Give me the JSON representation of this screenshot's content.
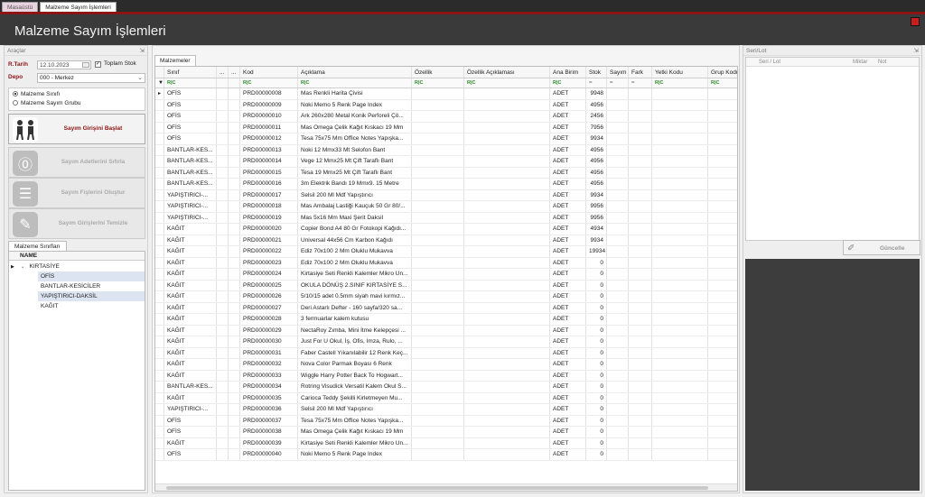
{
  "top_tabs": [
    {
      "label": "Masaüstü",
      "active": false
    },
    {
      "label": "Malzeme Sayım İşlemleri",
      "active": true
    }
  ],
  "header": {
    "title": "Malzeme Sayım İşlemleri"
  },
  "left": {
    "panel_title": "Araçlar",
    "pin": "⇲",
    "date_label": "R.Tarih",
    "date_value": "12.10.2023",
    "total_stock_label": "Toplam Stok",
    "total_stock_checked": true,
    "depo_label": "Depo",
    "depo_value": "000 - Merkez",
    "radio_options": [
      {
        "label": "Malzeme Sınıfı",
        "selected": true
      },
      {
        "label": "Malzeme Sayım Grubu",
        "selected": false
      }
    ],
    "buttons": [
      {
        "label": "Sayım Girişini Başlat",
        "enabled": true
      },
      {
        "label": "Sayım Adetlerini Sıfırla",
        "enabled": false
      },
      {
        "label": "Sayım Fişlerini Oluştur",
        "enabled": false
      },
      {
        "label": "Sayım Girişlerini Temizle",
        "enabled": false
      }
    ],
    "tree_tab": "Malzeme Sınıfları",
    "tree_header": "NAME",
    "tree": {
      "root": "KIRTASİYE",
      "children": [
        "OFİS",
        "BANTLAR-KESİCİLER",
        "YAPIŞTIRICI-DAKSİL",
        "KAĞIT"
      ]
    }
  },
  "grid": {
    "tab": "Malzemeler",
    "columns": [
      "Sınıf",
      "...",
      "...",
      "Kod",
      "Açıklama",
      "Özellik",
      "Özellik Açıklaması",
      "Ana Birim",
      "Stok",
      "Sayım",
      "Fark",
      "Yetki Kodu",
      "Grup Kodu"
    ],
    "filter_badge": "R|C",
    "filter_dash": "=",
    "rows": [
      [
        "OFİS",
        "PRD00000008",
        "Mas Renkli Harita Çivisi",
        "ADET",
        "9948"
      ],
      [
        "OFİS",
        "PRD00000009",
        "Noki Memo 5 Renk Page Index",
        "ADET",
        "4956"
      ],
      [
        "OFİS",
        "PRD00000010",
        "Ark 260x280 Metal Konik Perforeli Çö...",
        "ADET",
        "2456"
      ],
      [
        "OFİS",
        "PRD00000011",
        "Mas Omega Çelik Kağıt Kıskacı 19 Mm",
        "ADET",
        "7956"
      ],
      [
        "OFİS",
        "PRD00000012",
        "Tesa 75x75 Mm Office Notes Yapışka...",
        "ADET",
        "9934"
      ],
      [
        "BANTLAR-KES...",
        "PRD00000013",
        "Noki 12 Mmx33 Mt Selofon Bant",
        "ADET",
        "4956"
      ],
      [
        "BANTLAR-KES...",
        "PRD00000014",
        "Vege 12 Mmx25 Mt Çift Taraflı Bant",
        "ADET",
        "4956"
      ],
      [
        "BANTLAR-KES...",
        "PRD00000015",
        "Tesa 19 Mmx25 Mt Çift Taraflı Bant",
        "ADET",
        "4956"
      ],
      [
        "BANTLAR-KES...",
        "PRD00000016",
        "3m Elektrik Bandı 19 Mmx9. 15 Metre",
        "ADET",
        "4956"
      ],
      [
        "YAPIŞTIRICI-...",
        "PRD00000017",
        "Selsil 200 Ml Mdf Yapıştırıcı",
        "ADET",
        "9934"
      ],
      [
        "YAPIŞTIRICI-...",
        "PRD00000018",
        "Mas Ambalaj Lastiği Kauçuk 50 Gr 80/...",
        "ADET",
        "9956"
      ],
      [
        "YAPIŞTIRICI-...",
        "PRD00000019",
        "Mas 5x16 Mm Maxi Şerit Daksil",
        "ADET",
        "9956"
      ],
      [
        "KAĞIT",
        "PRD00000020",
        "Copier Bond A4 80 Gr Fotokopi Kağıdı...",
        "ADET",
        "4934"
      ],
      [
        "KAĞIT",
        "PRD00000021",
        "Universal 44x56 Cm Karbon Kağıdı",
        "ADET",
        "9934"
      ],
      [
        "KAĞIT",
        "PRD00000022",
        "Ediz 70x100 2 Mm Oluklu Mukavva",
        "ADET",
        "19934"
      ],
      [
        "KAĞIT",
        "PRD00000023",
        "Ediz 70x100 2 Mm Oluklu Mukavva",
        "ADET",
        "0"
      ],
      [
        "KAĞIT",
        "PRD00000024",
        "Kirtasiye Seti Renkli Kalemler Mikro Un...",
        "ADET",
        "0"
      ],
      [
        "KAĞIT",
        "PRD00000025",
        "OKULA DÖNÜŞ 2.SINIF KIRTASİYE S...",
        "ADET",
        "0"
      ],
      [
        "KAĞIT",
        "PRD00000026",
        "5/10/15 adet 0.5mm siyah mavi kırmız...",
        "ADET",
        "0"
      ],
      [
        "KAĞIT",
        "PRD00000027",
        "Deri Astarlı Defter - 160 sayfa/320 sa...",
        "ADET",
        "0"
      ],
      [
        "KAĞIT",
        "PRD00000028",
        "3 fermuarlar kalem kutusu",
        "ADET",
        "0"
      ],
      [
        "KAĞIT",
        "PRD00000029",
        "NectaRoy Zımba, Mini İtme Kelepçesi ...",
        "ADET",
        "0"
      ],
      [
        "KAĞIT",
        "PRD00000030",
        "Just For U Okul, İş, Ofis, Imza, Rulo, ...",
        "ADET",
        "0"
      ],
      [
        "KAĞIT",
        "PRD00000031",
        "Faber Castell Yıkanılabilir 12 Renk Keç...",
        "ADET",
        "0"
      ],
      [
        "KAĞIT",
        "PRD00000032",
        "Nova Color Parmak Boyası 6 Renk",
        "ADET",
        "0"
      ],
      [
        "KAĞIT",
        "PRD00000033",
        "Wiggle Harry Potter Back To Hogwart...",
        "ADET",
        "0"
      ],
      [
        "BANTLAR-KES...",
        "PRD00000034",
        "Rotring Visudick Versatil Kalem Okul S...",
        "ADET",
        "0"
      ],
      [
        "KAĞIT",
        "PRD00000035",
        "Carioca Teddy Şekilli Kirletmeyen Mu...",
        "ADET",
        "0"
      ],
      [
        "YAPIŞTIRICI-...",
        "PRD00000036",
        "Selsil 200 Ml Mdf Yapıştırıcı",
        "ADET",
        "0"
      ],
      [
        "OFİS",
        "PRD00000037",
        "Tesa 75x75 Mm Office Notes Yapışka...",
        "ADET",
        "0"
      ],
      [
        "OFİS",
        "PRD00000038",
        "Mas Omega Çelik Kağıt Kıskacı 19 Mm",
        "ADET",
        "0"
      ],
      [
        "KAĞIT",
        "PRD00000039",
        "Kirtasiye Seti Renkli Kalemler Mikro Un...",
        "ADET",
        "0"
      ],
      [
        "OFİS",
        "PRD00000040",
        "Noki Memo 5 Renk Page Index",
        "ADET",
        "0"
      ]
    ]
  },
  "right": {
    "panel_title": "Seri/Lot",
    "pin": "⇲",
    "columns": [
      "Seri / Lot",
      "Miktar",
      "Not"
    ],
    "update_label": "Güncelle"
  },
  "colors": {
    "accent": "#8b1414",
    "header_bg": "#3a3a3a",
    "dark_panel": "#3d3d3d"
  }
}
